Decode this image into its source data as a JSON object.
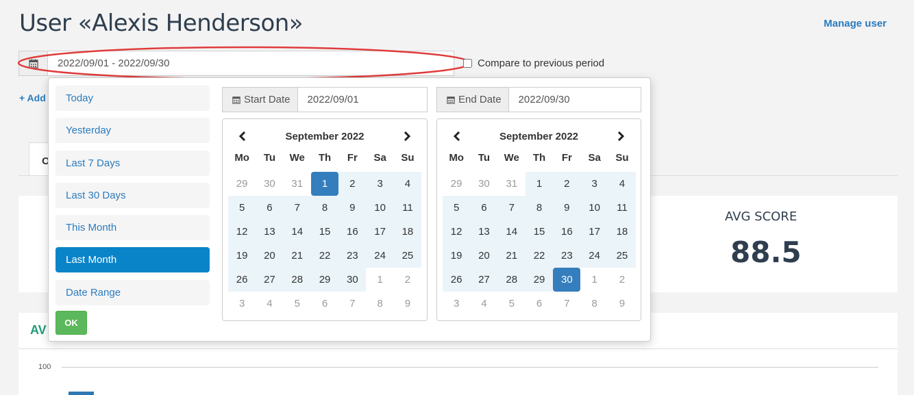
{
  "header": {
    "title": "User «Alexis Henderson»",
    "manage_link": "Manage user"
  },
  "date_filter": {
    "value": "2022/09/01 - 2022/09/30",
    "compare_label": "Compare to previous period"
  },
  "add_link": "+ Add",
  "tabs": [
    {
      "label": "O"
    }
  ],
  "stats": {
    "avg_score_label": "AVG SCORE",
    "avg_score_value": "88.5"
  },
  "chart": {
    "title": "AV",
    "y_tick": "100"
  },
  "picker": {
    "ranges": [
      "Today",
      "Yesterday",
      "Last 7 Days",
      "Last 30 Days",
      "This Month",
      "Last Month",
      "Date Range"
    ],
    "active_range": "Last Month",
    "ok_label": "OK",
    "start": {
      "label": "Start Date",
      "value": "2022/09/01"
    },
    "end": {
      "label": "End Date",
      "value": "2022/09/30"
    },
    "weekdays": [
      "Mo",
      "Tu",
      "We",
      "Th",
      "Fr",
      "Sa",
      "Su"
    ],
    "calendars": [
      {
        "month": "September 2022",
        "days": [
          [
            29,
            30,
            31,
            1,
            2,
            3,
            4
          ],
          [
            5,
            6,
            7,
            8,
            9,
            10,
            11
          ],
          [
            12,
            13,
            14,
            15,
            16,
            17,
            18
          ],
          [
            19,
            20,
            21,
            22,
            23,
            24,
            25
          ],
          [
            26,
            27,
            28,
            29,
            30,
            1,
            2
          ],
          [
            3,
            4,
            5,
            6,
            7,
            8,
            9
          ]
        ],
        "selected_day": 1
      },
      {
        "month": "September 2022",
        "days": [
          [
            29,
            30,
            31,
            1,
            2,
            3,
            4
          ],
          [
            5,
            6,
            7,
            8,
            9,
            10,
            11
          ],
          [
            12,
            13,
            14,
            15,
            16,
            17,
            18
          ],
          [
            19,
            20,
            21,
            22,
            23,
            24,
            25
          ],
          [
            26,
            27,
            28,
            29,
            30,
            1,
            2
          ],
          [
            3,
            4,
            5,
            6,
            7,
            8,
            9
          ]
        ],
        "selected_day": 30
      }
    ]
  },
  "colors": {
    "accent": "#2b7bbd",
    "active_range": "#0a84c9",
    "selected_day": "#357ebd",
    "in_range": "#ebf4f8",
    "ok_button": "#5cb85c",
    "annotation": "#e03b3b"
  }
}
